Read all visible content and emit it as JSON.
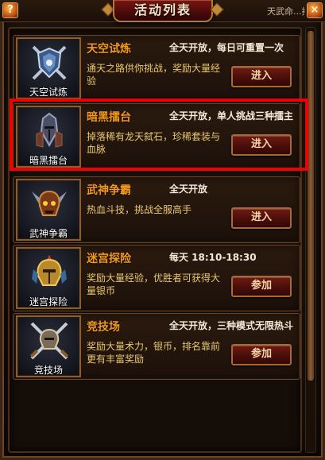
{
  "window": {
    "title": "活动列表",
    "help_label": "?",
    "close_label": "×",
    "top_right_text": "天武命...排行..."
  },
  "activities": [
    {
      "icon": "shield-crossed-swords-icon",
      "icon_label": "天空试炼",
      "name": "天空试炼",
      "time": "全天开放，每日可重置一次",
      "desc": "通天之路供你挑战，奖励大量经验",
      "button": "进入"
    },
    {
      "icon": "dark-knight-helmet-icon",
      "icon_label": "暗黑擂台",
      "name": "暗黑擂台",
      "time": "全天开放，单人挑战三种擂主",
      "desc": "掉落稀有龙天弑石，珍稀套装与血脉",
      "button": "进入"
    },
    {
      "icon": "demon-skull-axes-icon",
      "icon_label": "武神争霸",
      "name": "武神争霸",
      "time": "全天开放",
      "desc": "热血斗技，挑战全服高手",
      "button": "进入"
    },
    {
      "icon": "golden-warrior-helmet-icon",
      "icon_label": "迷宫探险",
      "name": "迷宫探险",
      "time": "每天  18:10-18:30",
      "desc": "奖励大量经验，优胜者可获得大量银币",
      "button": "参加"
    },
    {
      "icon": "crossed-swords-helmet-icon",
      "icon_label": "竞技场",
      "name": "竞技场",
      "time": "全天开放，三种模式无限热斗",
      "desc": "奖励大量术力，银币，排名靠前更有丰富奖励",
      "button": "参加"
    }
  ],
  "selected_index": 1
}
